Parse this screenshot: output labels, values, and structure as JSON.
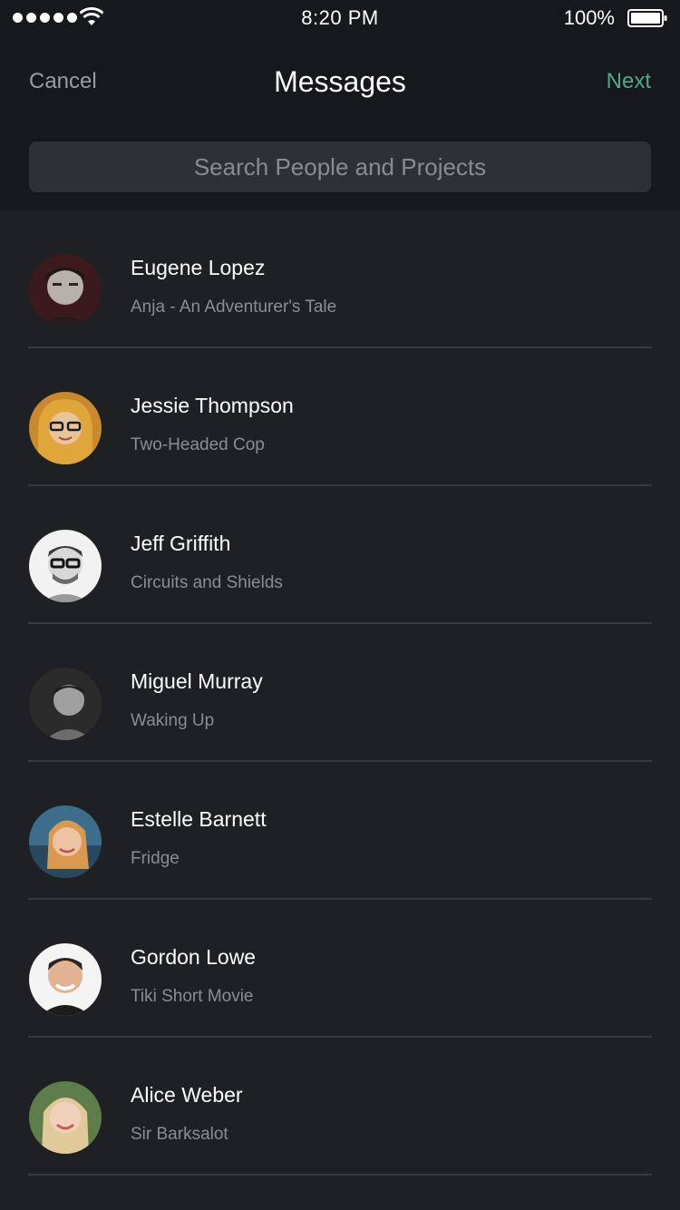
{
  "status_bar": {
    "time": "8:20 PM",
    "battery": "100%"
  },
  "nav": {
    "cancel_label": "Cancel",
    "title": "Messages",
    "next_label": "Next"
  },
  "search": {
    "placeholder": "Search People and Projects"
  },
  "colors": {
    "accent": "#4fa98b",
    "background": "#1f2024",
    "header_background": "#17181b"
  },
  "contacts": [
    {
      "name": "Eugene Lopez",
      "project": "Anja - An Adventurer's Tale"
    },
    {
      "name": "Jessie Thompson",
      "project": "Two-Headed Cop"
    },
    {
      "name": "Jeff Griffith",
      "project": "Circuits and Shields"
    },
    {
      "name": "Miguel Murray",
      "project": "Waking Up"
    },
    {
      "name": "Estelle Barnett",
      "project": "Fridge"
    },
    {
      "name": "Gordon Lowe",
      "project": "Tiki Short Movie"
    },
    {
      "name": "Alice Weber",
      "project": "Sir Barksalot"
    }
  ]
}
